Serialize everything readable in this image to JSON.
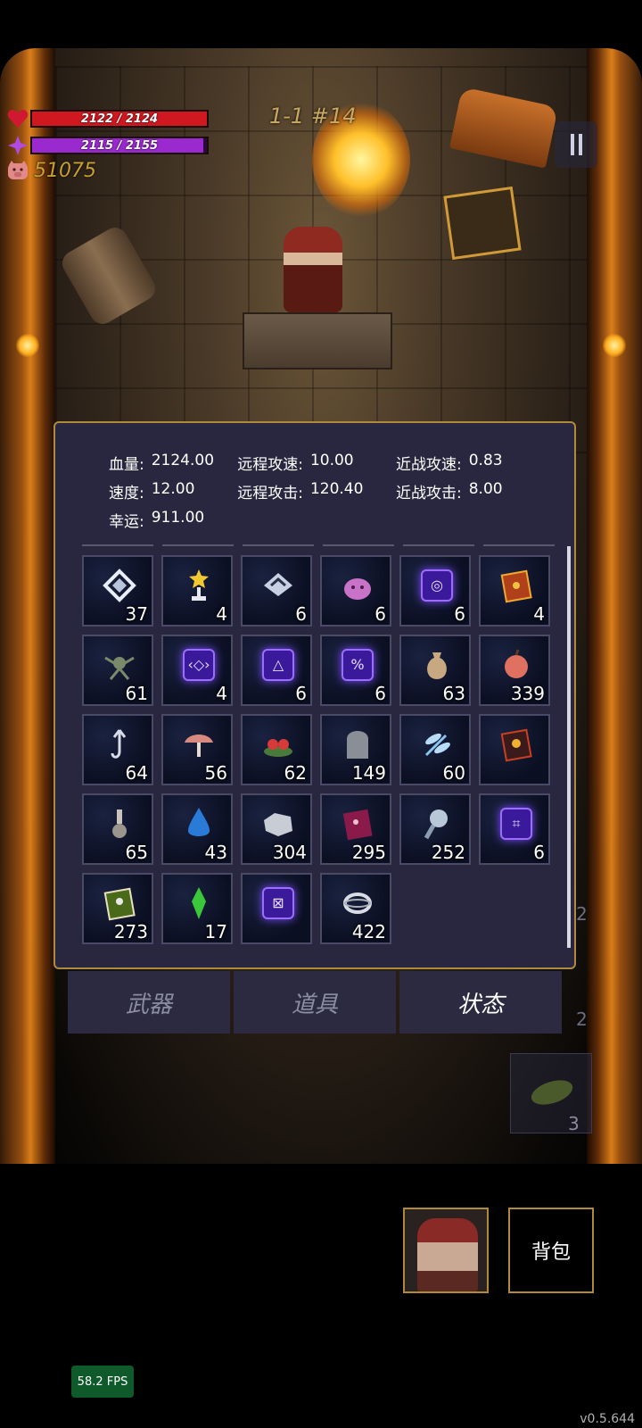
{
  "hud": {
    "hp_text": "2122 / 2124",
    "hp_fraction": 0.999,
    "mp_text": "2115 / 2155",
    "mp_fraction": 0.981,
    "coins": "51075"
  },
  "level_label": "1-1 #14",
  "stats": {
    "row1": [
      {
        "k": "血量:",
        "v": "2124.00"
      },
      {
        "k": "远程攻速:",
        "v": "10.00"
      },
      {
        "k": "近战攻速:",
        "v": "0.83"
      }
    ],
    "row2": [
      {
        "k": "速度:",
        "v": "12.00"
      },
      {
        "k": "远程攻击:",
        "v": "120.40"
      },
      {
        "k": "近战攻击:",
        "v": "8.00"
      }
    ],
    "row3": [
      {
        "k": "幸运:",
        "v": "911.00"
      }
    ]
  },
  "items": [
    {
      "icon": "diamond-tile-icon",
      "count": "37"
    },
    {
      "icon": "star-trophy-icon",
      "count": "4"
    },
    {
      "icon": "diamond-chevron-icon",
      "count": "6"
    },
    {
      "icon": "pink-slime-icon",
      "count": "6"
    },
    {
      "icon": "spiral-rune-icon",
      "count": "6"
    },
    {
      "icon": "red-book-icon",
      "count": "4"
    },
    {
      "icon": "green-creature-icon",
      "count": "61"
    },
    {
      "icon": "eye-rune-icon",
      "count": "4"
    },
    {
      "icon": "triangle-rune-icon",
      "count": "6"
    },
    {
      "icon": "percent-rune-icon",
      "count": "6"
    },
    {
      "icon": "pouch-icon",
      "count": "63"
    },
    {
      "icon": "peach-icon",
      "count": "339"
    },
    {
      "icon": "hook-arrow-icon",
      "count": "64"
    },
    {
      "icon": "mushroom-icon",
      "count": "56"
    },
    {
      "icon": "red-flower-icon",
      "count": "62"
    },
    {
      "icon": "tombstone-icon",
      "count": "149"
    },
    {
      "icon": "dragonfly-icon",
      "count": "60"
    },
    {
      "icon": "skull-book-icon",
      "count": ""
    },
    {
      "icon": "potion-bottle-icon",
      "count": "65"
    },
    {
      "icon": "water-drop-icon",
      "count": "43"
    },
    {
      "icon": "silver-ore-icon",
      "count": "304"
    },
    {
      "icon": "purple-book-icon",
      "count": "295"
    },
    {
      "icon": "magnifier-icon",
      "count": "252"
    },
    {
      "icon": "hash-rune-icon",
      "count": "6"
    },
    {
      "icon": "green-book-icon",
      "count": "273"
    },
    {
      "icon": "green-crystal-icon",
      "count": "17"
    },
    {
      "icon": "x-rune-icon",
      "count": ""
    },
    {
      "icon": "ring-icon",
      "count": "422"
    }
  ],
  "tabs": [
    {
      "label": "武器",
      "active": false
    },
    {
      "label": "道具",
      "active": false
    },
    {
      "label": "状态",
      "active": true
    }
  ],
  "side": {
    "num1": "2",
    "num2": "2",
    "num3": "3"
  },
  "bag_label": "背包",
  "fps": "58.2 FPS",
  "version": "v0.5.644"
}
